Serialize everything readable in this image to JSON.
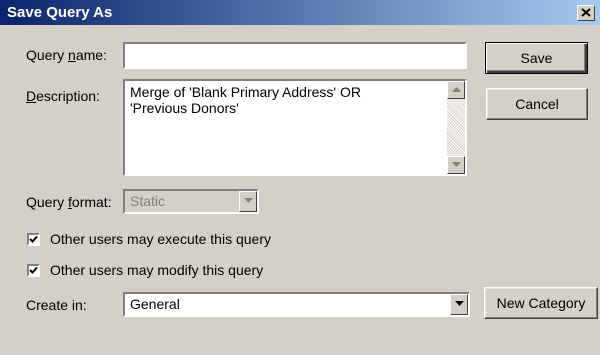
{
  "window": {
    "title": "Save Query As",
    "close_icon": "close-icon"
  },
  "labels": {
    "query_name_pre": "Query ",
    "query_name_u": "n",
    "query_name_post": "ame:",
    "description_u": "D",
    "description_post": "escription:",
    "query_format_pre": "Query ",
    "query_format_u": "f",
    "query_format_post": "ormat:",
    "create_in": "Create in:"
  },
  "fields": {
    "query_name": "",
    "description": "Merge of 'Blank Primary Address' OR\n'Previous Donors'",
    "query_format": "Static",
    "create_in": "General"
  },
  "checkboxes": [
    {
      "label": "Other users may execute this query",
      "checked": true
    },
    {
      "label": "Other users may modify this query",
      "checked": true
    }
  ],
  "buttons": {
    "save": "Save",
    "cancel": "Cancel",
    "new_category": "New Category"
  }
}
